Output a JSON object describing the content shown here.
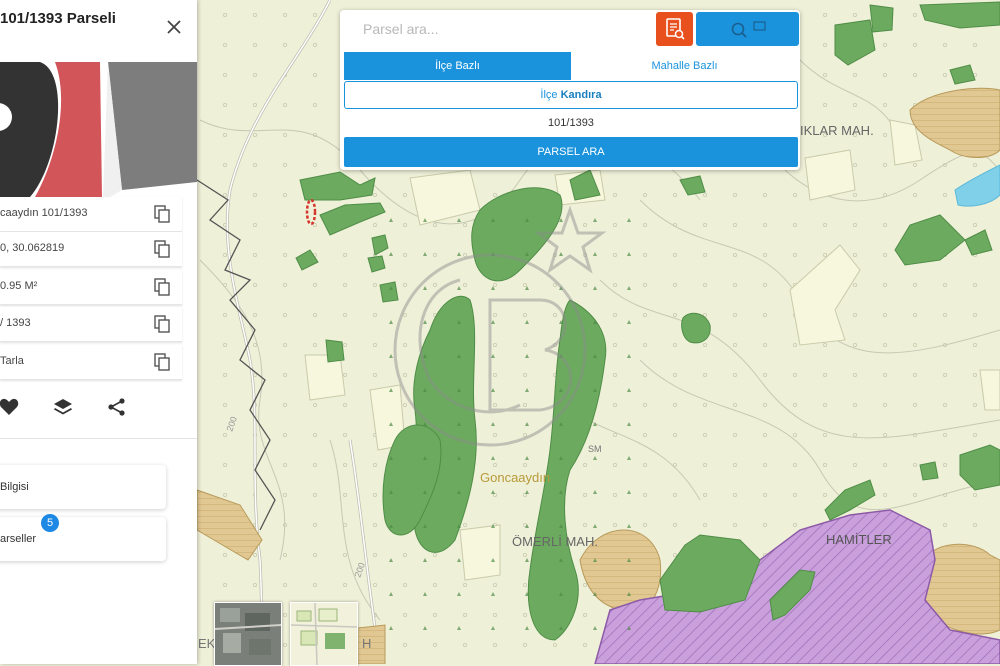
{
  "panel": {
    "title": "101/1393 Parseli",
    "rows": [
      {
        "text": "caaydın 101/1393"
      },
      {
        "text": "0, 30.062819"
      },
      {
        "text": "0.95 M²"
      },
      {
        "text": "/ 1393"
      },
      {
        "text": "Tarla"
      }
    ],
    "cards": [
      {
        "label": "Bilgisi"
      },
      {
        "label": "arseller"
      }
    ],
    "badge": "5"
  },
  "search": {
    "placeholder": "Parsel ara...",
    "tabs": [
      "İlçe Bazlı",
      "Mahalle Bazlı"
    ],
    "ilce_prefix": "İlçe",
    "ilce_value": "Kandıra",
    "parcel": "101/1393",
    "button": "PARSEL ARA"
  },
  "map": {
    "labels": {
      "iklar": "IKLAR MAH.",
      "goncaaydin": "Goncaaydın",
      "omerli": "ÖMERLİ MAH.",
      "hamitler": "HAMİTLER",
      "road_a": "200",
      "road_b": "200",
      "edge_left": "EK",
      "edge_h": "H"
    },
    "watermark_badge": "SM"
  },
  "colors": {
    "accent": "#1a93dc",
    "report_button": "#e8511e",
    "forest": "#6aab5e",
    "farmland": "#e3cf9a",
    "settlement": "#c8a0d8"
  },
  "icons": {
    "close": "close-icon",
    "copy": "copy-icon",
    "heart": "heart-icon",
    "layers": "layers-icon",
    "share": "share-icon",
    "report": "report-icon",
    "search": "search-icon"
  }
}
